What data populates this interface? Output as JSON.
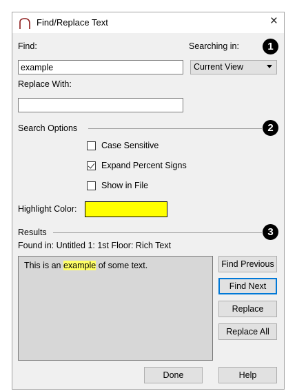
{
  "window": {
    "title": "Find/Replace Text",
    "close_glyph": "×",
    "icon": "arc-icon"
  },
  "find": {
    "label": "Find:",
    "value": "example"
  },
  "searching_in": {
    "label": "Searching in:",
    "selected": "Current View"
  },
  "replace": {
    "label": "Replace With:",
    "value": ""
  },
  "search_options": {
    "label": "Search Options",
    "checkboxes": [
      {
        "label": "Case Sensitive",
        "checked": false
      },
      {
        "label": "Expand Percent Signs",
        "checked": true
      },
      {
        "label": "Show in File",
        "checked": false
      }
    ]
  },
  "highlight": {
    "label": "Highlight Color:",
    "color": "#ffff00"
  },
  "results": {
    "label": "Results",
    "found_in": "Found in: Untitled 1: 1st Floor: Rich Text",
    "text_before": "This is an ",
    "text_match": "example",
    "text_after": " of some text."
  },
  "buttons": {
    "find_previous": "Find Previous",
    "find_next": "Find Next",
    "replace": "Replace",
    "replace_all": "Replace All",
    "done": "Done",
    "help": "Help"
  },
  "callouts": [
    "1",
    "2",
    "3"
  ]
}
